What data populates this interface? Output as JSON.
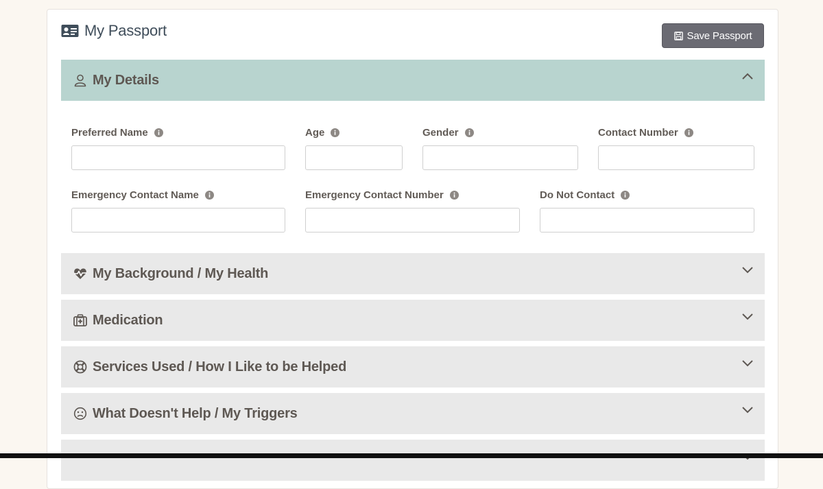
{
  "header": {
    "title": "My Passport",
    "title_icon": "id-card-icon",
    "save_label": "Save Passport",
    "save_icon": "floppy-disk-icon"
  },
  "sections": [
    {
      "label": "My Details",
      "icon": "user-icon",
      "open": true
    },
    {
      "label": "My Background / My Health",
      "icon": "heartbeat-icon",
      "open": false
    },
    {
      "label": "Medication",
      "icon": "medkit-icon",
      "open": false
    },
    {
      "label": "Services Used / How I Like to be Helped",
      "icon": "life-ring-icon",
      "open": false
    },
    {
      "label": "What Doesn't Help / My Triggers",
      "icon": "frown-icon",
      "open": false
    },
    {
      "label": "",
      "icon": "",
      "open": false
    }
  ],
  "fields": [
    {
      "label": "Preferred Name",
      "value": "",
      "placeholder": ""
    },
    {
      "label": "Age",
      "value": "",
      "placeholder": ""
    },
    {
      "label": "Gender",
      "value": "",
      "placeholder": ""
    },
    {
      "label": "Contact Number",
      "value": "",
      "placeholder": ""
    },
    {
      "label": "Emergency Contact Name",
      "value": "",
      "placeholder": ""
    },
    {
      "label": "Emergency Contact Number",
      "value": "",
      "placeholder": ""
    },
    {
      "label": "Do Not Contact",
      "value": "",
      "placeholder": ""
    }
  ],
  "colors": {
    "open_section": "#b8d4cf",
    "closed_section": "#e9e9e9",
    "button": "#6b6b73",
    "title": "#3f4d5a"
  }
}
